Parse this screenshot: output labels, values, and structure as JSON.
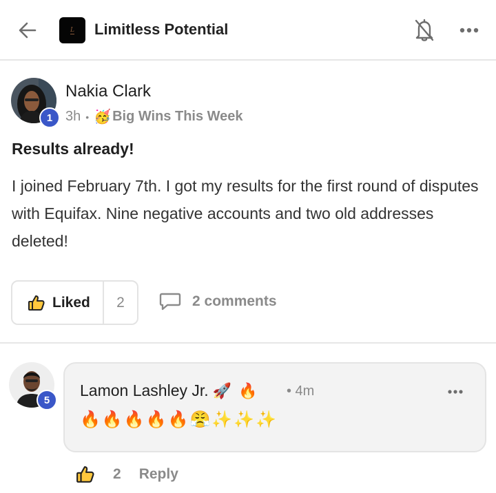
{
  "header": {
    "group_name": "Limitless Potential",
    "logo_icon": "group-logo",
    "back_icon": "arrow-left-icon",
    "bell_icon": "bell-off-icon",
    "more_icon": "more-horizontal-icon"
  },
  "post": {
    "author": "Nakia Clark",
    "author_level": "1",
    "time": "3h",
    "separator": "•",
    "category": "Big Wins This Week",
    "category_icon": "partying-face-emoji",
    "title": "Results already!",
    "body": "I joined February 7th. I got my results for the first round of disputes with Equifax. Nine negative accounts and two old addresses deleted!",
    "like_label": "Liked",
    "like_count": "2",
    "comments_label": "2 comments"
  },
  "comment": {
    "author": "Lamon Lashley Jr.",
    "author_emojis": [
      "rocket-emoji",
      "fire-emoji"
    ],
    "author_level": "5",
    "time": "• 4m",
    "text_emojis": [
      "fire",
      "fire",
      "fire",
      "fire",
      "fire",
      "face-with-steam",
      "sparkles",
      "sparkles",
      "sparkles"
    ],
    "like_count": "2",
    "reply_label": "Reply"
  },
  "colors": {
    "badge": "#3a57c8",
    "muted_text": "#8a8a8a",
    "divider": "#e6e6e6",
    "comment_bg": "#f3f3f3"
  }
}
